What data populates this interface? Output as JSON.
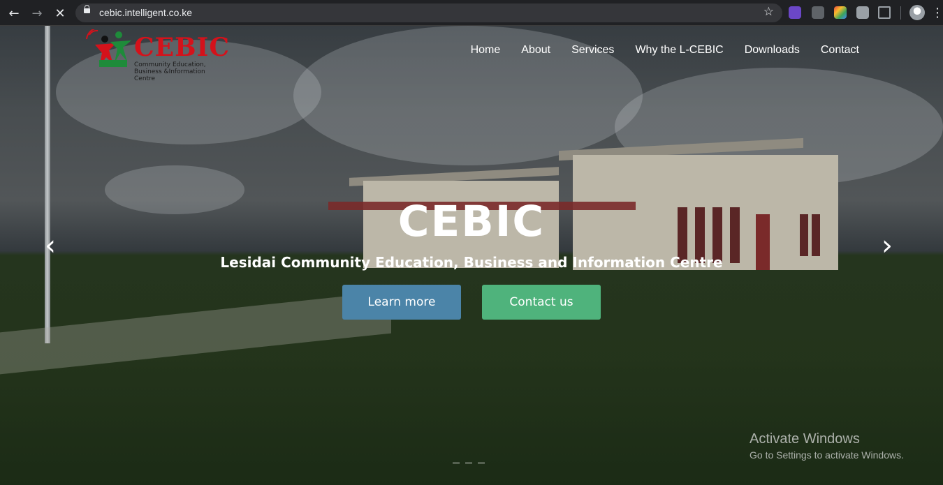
{
  "browser": {
    "url": "cebic.intelligent.co.ke",
    "back_icon": "←",
    "forward_icon": "→",
    "stop_icon": "✕",
    "star_icon": "☆",
    "menu_icon": "⋮"
  },
  "logo": {
    "title": "CEBIC",
    "subtitle_line1": "Community Education,",
    "subtitle_line2": "Business &Information Centre"
  },
  "nav": {
    "items": [
      {
        "label": "Home"
      },
      {
        "label": "About"
      },
      {
        "label": "Services"
      },
      {
        "label": "Why the L-CEBIC"
      },
      {
        "label": "Downloads"
      },
      {
        "label": "Contact"
      }
    ]
  },
  "hero": {
    "title": "CEBIC",
    "subtitle": "Lesidai Community Education, Business and Information Centre",
    "learn_more_label": "Learn more",
    "contact_label": "Contact us",
    "prev_icon": "‹",
    "next_icon": "›"
  },
  "watermark": {
    "title": "Activate Windows",
    "subtitle": "Go to Settings to activate Windows."
  },
  "colors": {
    "brand_red": "#d4121b",
    "learn_more_bg": "#4b84a8",
    "contact_bg": "#4fb37c"
  }
}
